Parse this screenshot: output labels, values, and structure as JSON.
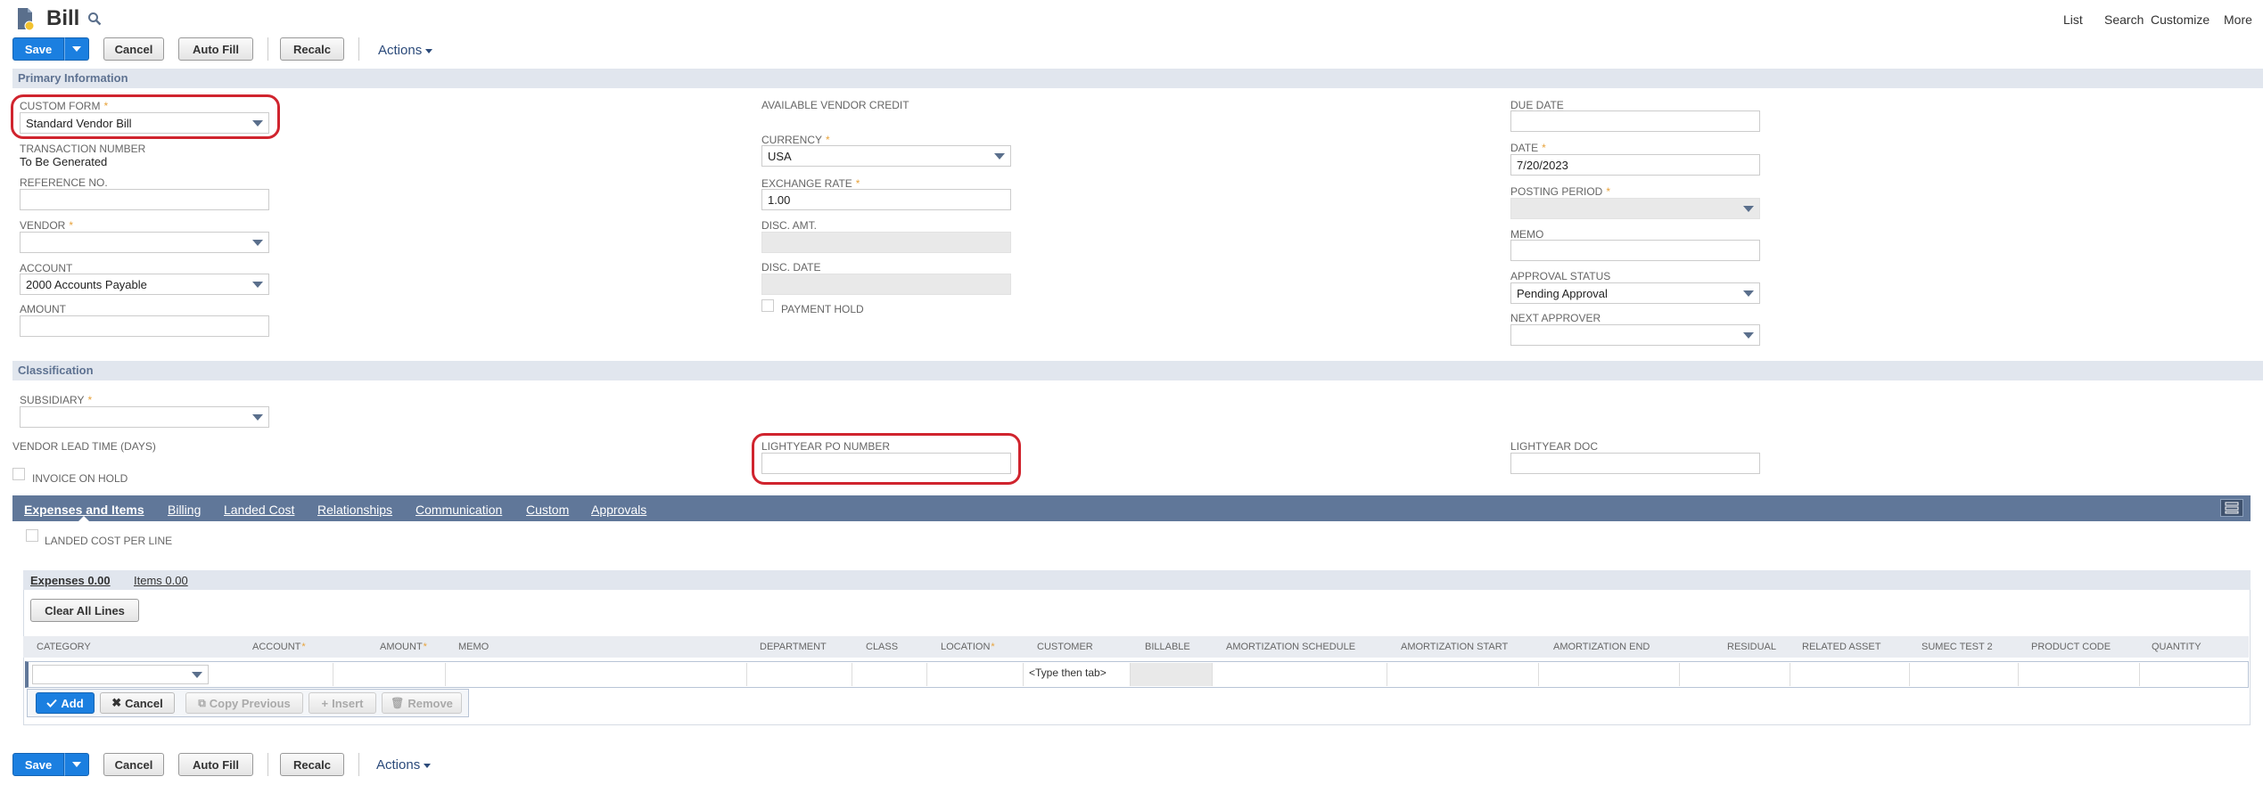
{
  "page": {
    "title": "Bill"
  },
  "top_links": {
    "list": "List",
    "search": "Search",
    "customize": "Customize",
    "more": "More"
  },
  "toolbar": {
    "save": "Save",
    "cancel": "Cancel",
    "auto_fill": "Auto Fill",
    "recalc": "Recalc",
    "actions": "Actions"
  },
  "primary": {
    "section": "Primary Information",
    "custom_form": {
      "label": "CUSTOM FORM",
      "value": "Standard Vendor Bill"
    },
    "transaction_number": {
      "label": "TRANSACTION NUMBER",
      "value": "To Be Generated"
    },
    "reference_no": {
      "label": "REFERENCE NO.",
      "value": ""
    },
    "vendor": {
      "label": "VENDOR",
      "value": ""
    },
    "account": {
      "label": "ACCOUNT",
      "value": "2000 Accounts Payable"
    },
    "amount": {
      "label": "AMOUNT",
      "value": ""
    },
    "available_vendor_credit": {
      "label": "AVAILABLE VENDOR CREDIT"
    },
    "currency": {
      "label": "CURRENCY",
      "value": "USA"
    },
    "exchange_rate": {
      "label": "EXCHANGE RATE",
      "value": "1.00"
    },
    "disc_amt": {
      "label": "DISC. AMT."
    },
    "disc_date": {
      "label": "DISC. DATE"
    },
    "payment_hold": {
      "label": "PAYMENT HOLD"
    },
    "due_date": {
      "label": "DUE DATE",
      "value": ""
    },
    "date": {
      "label": "DATE",
      "value": "7/20/2023"
    },
    "posting_period": {
      "label": "POSTING PERIOD",
      "value": ""
    },
    "memo": {
      "label": "MEMO",
      "value": ""
    },
    "approval_status": {
      "label": "APPROVAL STATUS",
      "value": "Pending Approval"
    },
    "next_approver": {
      "label": "NEXT APPROVER",
      "value": ""
    }
  },
  "classification": {
    "section": "Classification",
    "subsidiary": {
      "label": "SUBSIDIARY",
      "value": ""
    },
    "vendor_lead_time": {
      "label": "VENDOR LEAD TIME (DAYS)"
    },
    "invoice_on_hold": {
      "label": "INVOICE ON HOLD"
    },
    "lightyear_po": {
      "label": "LIGHTYEAR PO NUMBER",
      "value": ""
    },
    "lightyear_doc": {
      "label": "LIGHTYEAR DOC",
      "value": ""
    }
  },
  "subtabs": [
    "Expenses and Items",
    "Billing",
    "Landed Cost",
    "Relationships",
    "Communication",
    "Custom",
    "Approvals"
  ],
  "landed_cost_per_line": "LANDED COST PER LINE",
  "inner_tabs": {
    "expenses": "Expenses 0.00",
    "items": "Items 0.00"
  },
  "clear_all_lines": "Clear All Lines",
  "columns": [
    "CATEGORY",
    "ACCOUNT",
    "AMOUNT",
    "MEMO",
    "DEPARTMENT",
    "CLASS",
    "LOCATION",
    "CUSTOMER",
    "BILLABLE",
    "AMORTIZATION SCHEDULE",
    "AMORTIZATION START",
    "AMORTIZATION END",
    "RESIDUAL",
    "RELATED ASSET",
    "SUMEC TEST 2",
    "PRODUCT CODE",
    "QUANTITY"
  ],
  "row": {
    "customer_placeholder": "<Type then tab>"
  },
  "line_buttons": {
    "add": "Add",
    "cancel": "Cancel",
    "copy_previous": "Copy Previous",
    "insert": "Insert",
    "remove": "Remove"
  },
  "colors": {
    "primary_blue": "#1b7fe0",
    "tab_bar": "#607799",
    "section_bg": "#e1e6ee",
    "highlight_red": "#d0242e",
    "required_star": "#e8a33c"
  }
}
